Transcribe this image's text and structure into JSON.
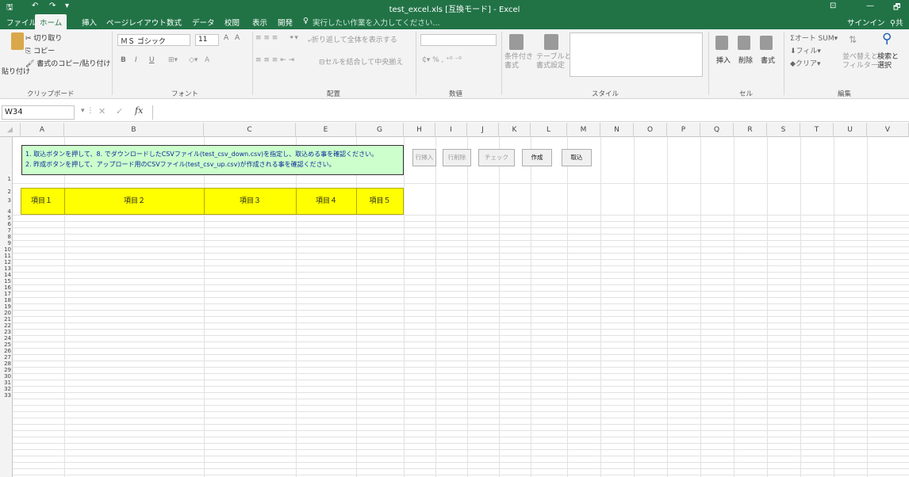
{
  "window": {
    "title": "test_excel.xls [互換モード] - Excel",
    "minimize": "—",
    "restore": "🗗",
    "ribbon_display": "⊡"
  },
  "qat": {
    "save": "🖫",
    "undo": "↶",
    "redo": "↷",
    "customize": "▾"
  },
  "tabs": [
    "ファイル",
    "ホーム",
    "挿入",
    "ページレイアウト",
    "数式",
    "データ",
    "校閲",
    "表示",
    "開発"
  ],
  "tell_me": "実行したい作業を入力してください...",
  "account": {
    "signin": "サインイン",
    "share": "共"
  },
  "ribbon": {
    "clipboard": {
      "paste": "貼り付け",
      "cut": "切り取り",
      "copy": "コピー",
      "format_painter": "書式のコピー/貼り付け",
      "group": "クリップボード"
    },
    "font": {
      "name": "ＭＳ ゴシック",
      "size": "11",
      "bold": "B",
      "italic": "I",
      "underline": "U",
      "grow": "A",
      "shrink": "A",
      "font_color": "A",
      "group": "フォント"
    },
    "alignment": {
      "wrap": "折り返して全体を表示する",
      "merge": "セルを結合して中央揃え",
      "group": "配置"
    },
    "number": {
      "percent": "%",
      "comma": ",",
      "group": "数値"
    },
    "styles": {
      "conditional": "条件付き\n書式",
      "table": "テーブルとして\n書式設定",
      "group": "スタイル"
    },
    "cells": {
      "insert": "挿入",
      "delete": "削除",
      "format": "書式",
      "group": "セル"
    },
    "editing": {
      "autosum": "オート SUM",
      "fill": "フィル",
      "clear": "クリア",
      "sort": "並べ替えと\nフィルター",
      "find": "検索と\n選択",
      "group": "編集"
    }
  },
  "formula_bar": {
    "name_box": "W34",
    "fx": "fx",
    "value": ""
  },
  "columns": [
    "A",
    "B",
    "C",
    "E",
    "G",
    "H",
    "I",
    "J",
    "K",
    "L",
    "M",
    "N",
    "O",
    "P",
    "Q",
    "R",
    "S",
    "T",
    "U",
    "V"
  ],
  "rows": [
    "1",
    "2",
    "3",
    "4",
    "5",
    "6",
    "7",
    "8",
    "9",
    "10",
    "11",
    "12",
    "13",
    "14",
    "15",
    "16",
    "17",
    "18",
    "19",
    "20",
    "21",
    "22",
    "23",
    "24",
    "25",
    "26",
    "27",
    "28",
    "29",
    "30",
    "31",
    "32",
    "33"
  ],
  "note": {
    "line1": "1. 取込ボタンを押して、8. でダウンロードしたCSVファイル(test_csv_down.csv)を指定し、取込める事を確認ください。",
    "line2": "2. 昨成ボタンを押して、アップロード用のCSVファイル(test_csv_up.csv)が作成される事を確認ください。"
  },
  "headers": [
    "項目１",
    "項目２",
    "項目３",
    "項目４",
    "項目５"
  ],
  "buttons": {
    "row_insert": "行挿入",
    "row_delete": "行削除",
    "check": "チェック",
    "create": "作成",
    "import": "取込"
  }
}
